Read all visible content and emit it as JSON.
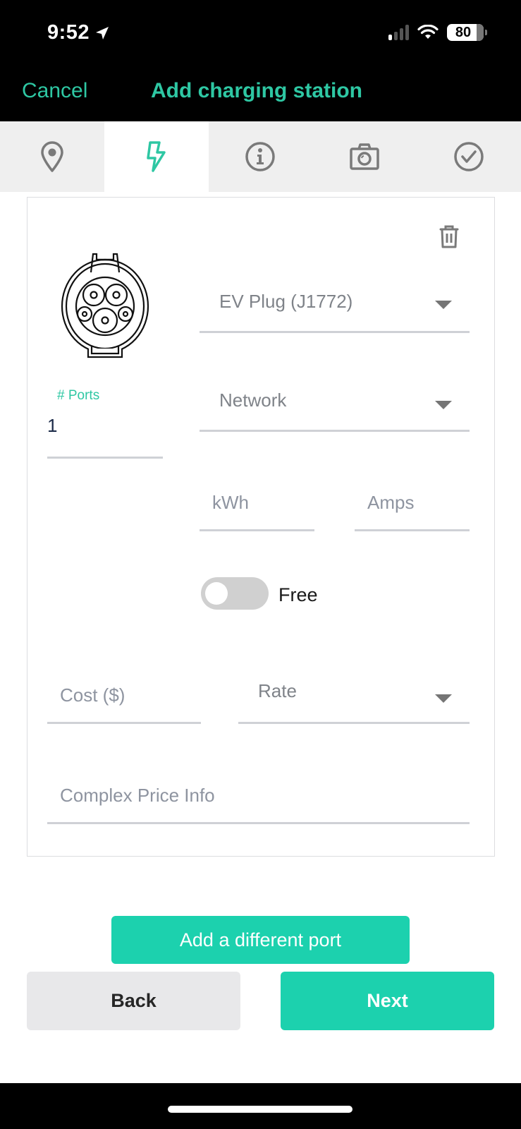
{
  "status_bar": {
    "time": "9:52",
    "battery": "80",
    "signal_bars_active": 1,
    "signal_bars_total": 4,
    "icons": [
      "location-arrow-icon",
      "cellular-signal-icon",
      "wifi-icon",
      "battery-icon"
    ]
  },
  "nav": {
    "cancel_label": "Cancel",
    "title": "Add charging station"
  },
  "tabs": [
    {
      "name": "location",
      "icon": "map-pin-icon",
      "active": false
    },
    {
      "name": "plug",
      "icon": "lightning-bolt-icon",
      "active": true
    },
    {
      "name": "info",
      "icon": "info-icon",
      "active": false
    },
    {
      "name": "photo",
      "icon": "camera-icon",
      "active": false
    },
    {
      "name": "review",
      "icon": "checkmark-circle-icon",
      "active": false
    }
  ],
  "port_card": {
    "plug_icon": "j1772-plug-icon",
    "delete_icon": "trash-icon",
    "plug_type": {
      "value": "EV Plug (J1772)"
    },
    "ports": {
      "label": "# Ports",
      "value": "1"
    },
    "network": {
      "placeholder": "Network"
    },
    "kwh": {
      "placeholder": "kWh"
    },
    "amps": {
      "placeholder": "Amps"
    },
    "free_toggle": {
      "label": "Free",
      "on": false
    },
    "cost": {
      "placeholder": "Cost ($)"
    },
    "rate": {
      "placeholder": "Rate"
    },
    "complex_price": {
      "placeholder": "Complex Price Info"
    }
  },
  "actions": {
    "add_port_label": "Add a different port",
    "back_label": "Back",
    "next_label": "Next"
  },
  "colors": {
    "accent": "#1cd1ae",
    "header_text": "#2ec7a3",
    "tab_active_icon": "#2ec7a3",
    "tab_icon": "#7a7a7a"
  }
}
